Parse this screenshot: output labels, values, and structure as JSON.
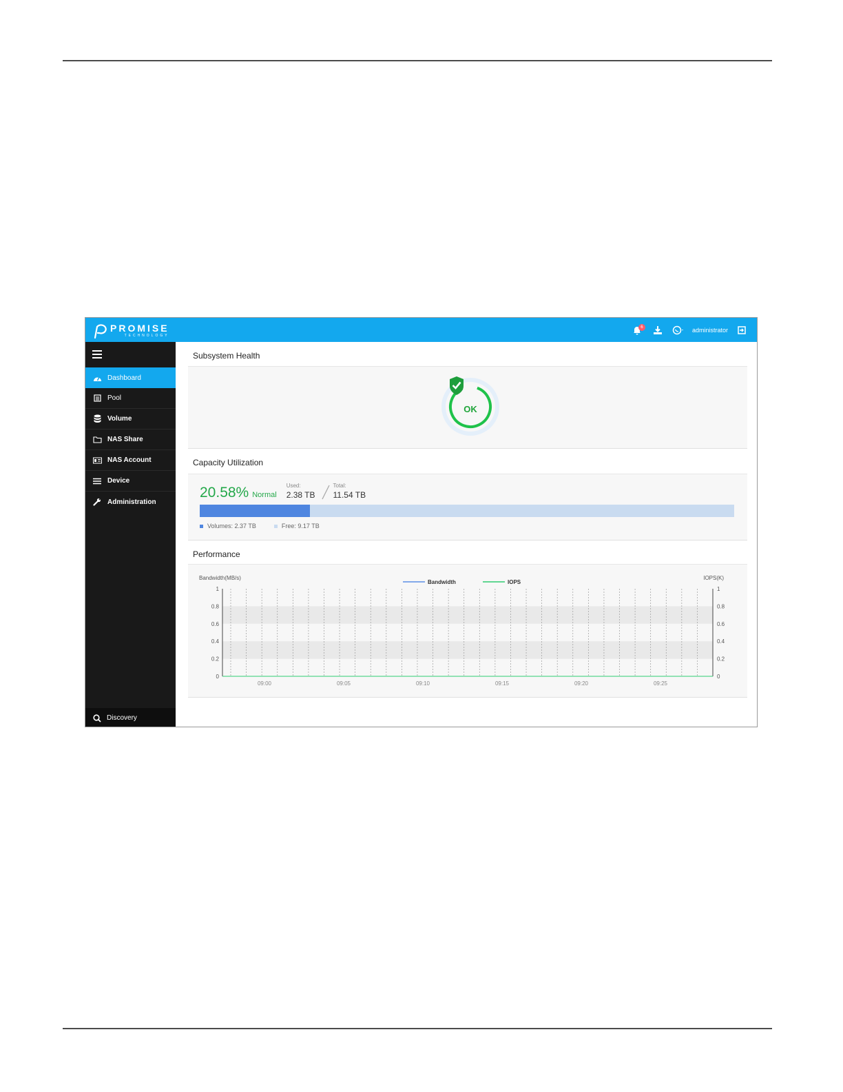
{
  "brand": {
    "name": "PROMISE",
    "sub": "TECHNOLOGY"
  },
  "header": {
    "notification_count": "6",
    "user": "administrator"
  },
  "sidebar": {
    "items": [
      {
        "label": "Dashboard",
        "icon": "dashboard-icon",
        "active": true
      },
      {
        "label": "Pool",
        "icon": "pool-icon"
      },
      {
        "label": "Volume",
        "icon": "database-icon"
      },
      {
        "label": "NAS Share",
        "icon": "folder-icon"
      },
      {
        "label": "NAS Account",
        "icon": "account-icon"
      },
      {
        "label": "Device",
        "icon": "list-icon"
      },
      {
        "label": "Administration",
        "icon": "wrench-icon"
      }
    ],
    "discovery": "Discovery"
  },
  "health": {
    "title": "Subsystem Health",
    "status": "OK"
  },
  "capacity": {
    "title": "Capacity Utilization",
    "percent": "20.58%",
    "status": "Normal",
    "used_label": "Used:",
    "used": "2.38 TB",
    "total_label": "Total:",
    "total": "11.54 TB",
    "fill_fraction": 0.2058,
    "legend_volumes": "Volumes: 2.37 TB",
    "legend_free": "Free: 9.17 TB",
    "colors": {
      "used": "#4f86e0",
      "free": "#c9dbf0"
    }
  },
  "performance": {
    "title": "Performance"
  },
  "chart_data": {
    "type": "line",
    "y_left_label": "Bandwidth(MB/s)",
    "y_right_label": "IOPS(K)",
    "y_ticks": [
      "0",
      "0.2",
      "0.4",
      "0.6",
      "0.8",
      "1"
    ],
    "ylim": [
      0,
      1
    ],
    "x_ticks": [
      "09:00",
      "09:05",
      "09:10",
      "09:15",
      "09:20",
      "09:25"
    ],
    "grid": true,
    "legend_position": "top-center",
    "series": [
      {
        "name": "Bandwidth",
        "color": "#5b8ee6",
        "values": []
      },
      {
        "name": "IOPS",
        "color": "#2ecc71",
        "values": []
      }
    ]
  }
}
